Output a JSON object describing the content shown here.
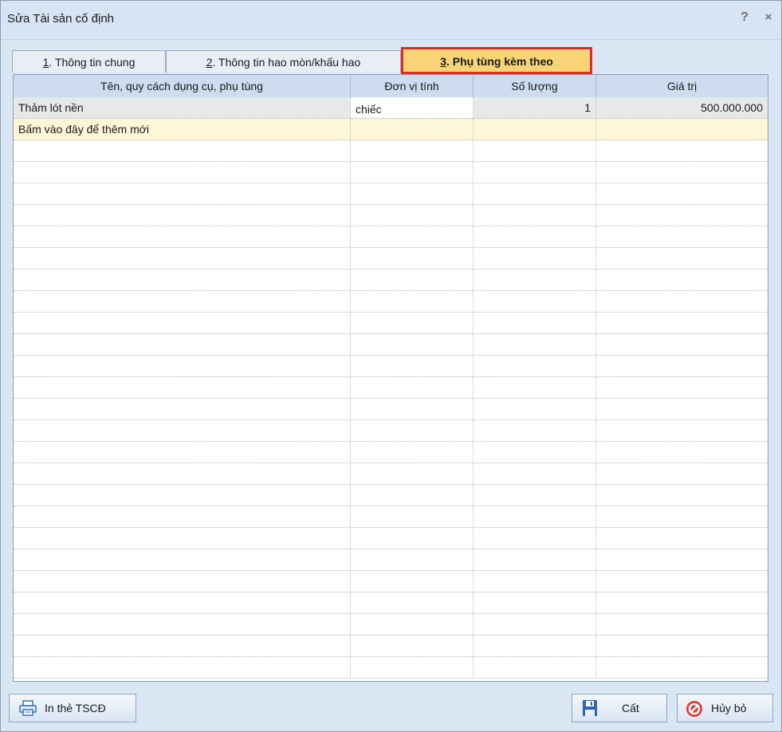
{
  "window": {
    "title": "Sửa Tài sản cố định",
    "help_label": "?",
    "close_label": "×"
  },
  "tabs": [
    {
      "num": "1",
      "text": ". Thông tin chung"
    },
    {
      "num": "2",
      "text": ". Thông tin hao mòn/khấu hao"
    },
    {
      "num": "3",
      "text": ". Phụ tùng kèm theo"
    }
  ],
  "active_tab_index": 2,
  "table": {
    "headers": [
      "Tên, quy cách dụng cụ, phụ tùng",
      "Đơn vị tính",
      "Số lượng",
      "Giá trị"
    ],
    "rows": [
      {
        "name": "Thảm lót nền",
        "unit": "chiếc",
        "qty": "1",
        "value": "500.000.000"
      }
    ],
    "new_row_label": "Bấm vào đây để thêm mới"
  },
  "buttons": {
    "print_label": "In thẻ TSCĐ",
    "save_label": "Cất",
    "cancel_label": "Hủy bỏ"
  },
  "colors": {
    "active_tab_bg": "#f9d477",
    "highlight_border": "#e02b2b",
    "header_bg": "#cddcef",
    "new_row_bg": "#fdf7d7"
  },
  "icons": {
    "print": "printer-icon",
    "save": "floppy-disk-icon",
    "cancel": "cancel-icon"
  }
}
